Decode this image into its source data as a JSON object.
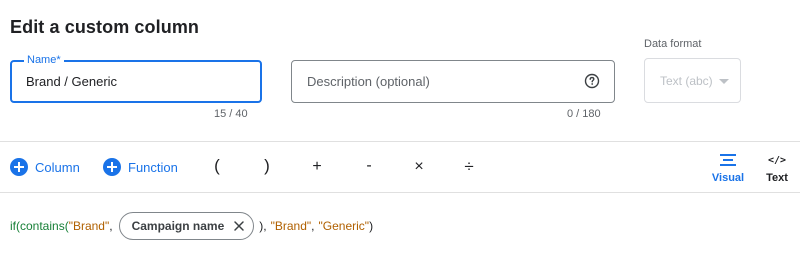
{
  "dialog": {
    "title": "Edit a custom column"
  },
  "name_field": {
    "label": "Name*",
    "value": "Brand / Generic",
    "counter": "15 / 40"
  },
  "description_field": {
    "placeholder": "Description (optional)",
    "counter": "0 / 180",
    "help_icon": "help-circle-icon"
  },
  "data_format": {
    "label": "Data format",
    "value": "Text (abc)"
  },
  "toolbar": {
    "column_label": "Column",
    "function_label": "Function",
    "operators": {
      "open_paren": "(",
      "close_paren": ")",
      "plus": "+",
      "minus": "-",
      "times": "×",
      "divide": "÷"
    },
    "visual_label": "Visual",
    "text_label": "Text",
    "text_icon_glyph": "</>"
  },
  "formula": {
    "fn_prefix": "if(contains(",
    "arg_brand": "\"Brand\"",
    "comma1": ",",
    "chip_label": "Campaign name",
    "after_chip": "),",
    "arg_brand_result": "\"Brand\"",
    "comma2": ",",
    "arg_generic": "\"Generic\"",
    "close": ")"
  },
  "colors": {
    "accent": "#1a73e8",
    "function": "#188038",
    "string": "#b06000"
  }
}
